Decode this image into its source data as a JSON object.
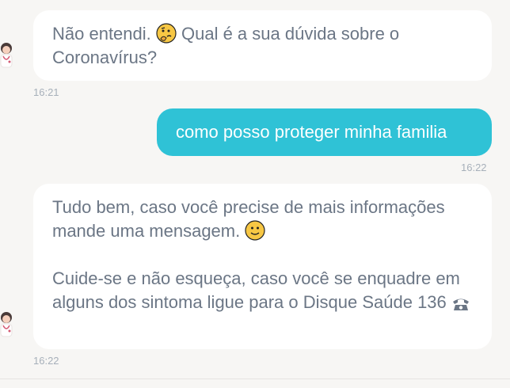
{
  "messages": [
    {
      "sender": "bot",
      "text_before_emoji": "Não entendi. ",
      "emoji": "thinking-emoji",
      "text_after_emoji": " Qual é a sua dúvida sobre o Coronavírus?",
      "time": "16:21"
    },
    {
      "sender": "user",
      "text": "como posso proteger minha familia",
      "time": "16:22"
    },
    {
      "sender": "bot",
      "paragraph_1": "Tudo bem, caso você precise de mais informações mande uma mensagem. ",
      "paragraph_1_emoji": "smile-emoji",
      "paragraph_2": "Cuide-se e não esqueça, caso você se enquadre em alguns dos sintoma ligue para o Disque Saúde 136 ",
      "paragraph_2_icon": "telephone-icon",
      "time": "16:22"
    }
  ],
  "colors": {
    "background": "#f7f6f4",
    "bot_bubble": "#ffffff",
    "bot_text": "#6b7685",
    "user_bubble": "#2fc2d6",
    "user_text": "#ffffff",
    "timestamp": "#a7b0ba"
  }
}
